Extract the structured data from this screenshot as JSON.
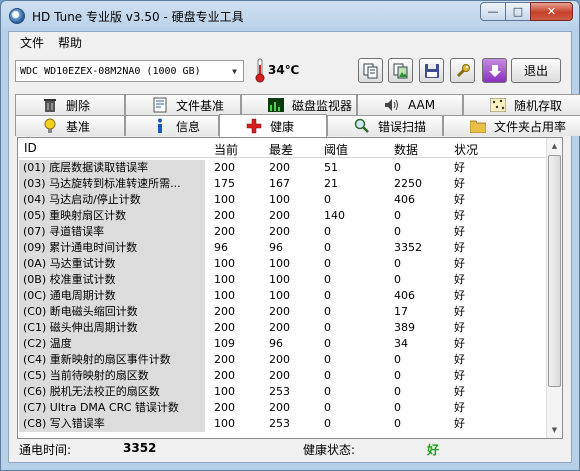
{
  "window": {
    "title": "HD Tune 专业版 v3.50 - 硬盘专业工具",
    "min_glyph": "—",
    "max_glyph": "□",
    "close_glyph": "✕"
  },
  "menu": [
    "文件",
    "帮助"
  ],
  "toolbar": {
    "drive": "WDC WD10EZEX-08M2NA0 (1000 GB)",
    "temperature": "34℃",
    "exit_label": "退出"
  },
  "tabs": {
    "row1": [
      {
        "label": "删除",
        "icon": "trash-icon"
      },
      {
        "label": "文件基准",
        "icon": "file-benchmark-icon"
      },
      {
        "label": "磁盘监视器",
        "icon": "disk-monitor-icon"
      },
      {
        "label": "AAM",
        "icon": "speaker-icon"
      },
      {
        "label": "随机存取",
        "icon": "random-access-icon"
      }
    ],
    "row2": [
      {
        "label": "基准",
        "icon": "lightbulb-icon"
      },
      {
        "label": "信息",
        "icon": "info-icon"
      },
      {
        "label": "健康",
        "icon": "red-cross-icon"
      },
      {
        "label": "错误扫描",
        "icon": "magnifier-icon"
      },
      {
        "label": "文件夹占用率",
        "icon": "folder-icon"
      }
    ],
    "active": "健康"
  },
  "table": {
    "headers": {
      "id": "ID",
      "current": "当前",
      "worst": "最差",
      "threshold": "阈值",
      "data": "数据",
      "status": "状况"
    },
    "rows": [
      {
        "id": "(01) 底层数据读取错误率",
        "current": "200",
        "worst": "200",
        "threshold": "51",
        "data": "0",
        "status": "好"
      },
      {
        "id": "(03) 马达旋转到标准转速所需...",
        "current": "175",
        "worst": "167",
        "threshold": "21",
        "data": "2250",
        "status": "好"
      },
      {
        "id": "(04) 马达启动/停止计数",
        "current": "100",
        "worst": "100",
        "threshold": "0",
        "data": "406",
        "status": "好"
      },
      {
        "id": "(05) 重映射扇区计数",
        "current": "200",
        "worst": "200",
        "threshold": "140",
        "data": "0",
        "status": "好"
      },
      {
        "id": "(07) 寻道错误率",
        "current": "200",
        "worst": "200",
        "threshold": "0",
        "data": "0",
        "status": "好"
      },
      {
        "id": "(09) 累计通电时间计数",
        "current": "96",
        "worst": "96",
        "threshold": "0",
        "data": "3352",
        "status": "好"
      },
      {
        "id": "(0A) 马达重试计数",
        "current": "100",
        "worst": "100",
        "threshold": "0",
        "data": "0",
        "status": "好"
      },
      {
        "id": "(0B) 校准重试计数",
        "current": "100",
        "worst": "100",
        "threshold": "0",
        "data": "0",
        "status": "好"
      },
      {
        "id": "(0C) 通电周期计数",
        "current": "100",
        "worst": "100",
        "threshold": "0",
        "data": "406",
        "status": "好"
      },
      {
        "id": "(C0) 断电磁头缩回计数",
        "current": "200",
        "worst": "200",
        "threshold": "0",
        "data": "17",
        "status": "好"
      },
      {
        "id": "(C1) 磁头伸出周期计数",
        "current": "200",
        "worst": "200",
        "threshold": "0",
        "data": "389",
        "status": "好"
      },
      {
        "id": "(C2) 温度",
        "current": "109",
        "worst": "96",
        "threshold": "0",
        "data": "34",
        "status": "好"
      },
      {
        "id": "(C4) 重新映射的扇区事件计数",
        "current": "200",
        "worst": "200",
        "threshold": "0",
        "data": "0",
        "status": "好"
      },
      {
        "id": "(C5) 当前待映射的扇区数",
        "current": "200",
        "worst": "200",
        "threshold": "0",
        "data": "0",
        "status": "好"
      },
      {
        "id": "(C6) 脱机无法校正的扇区数",
        "current": "100",
        "worst": "253",
        "threshold": "0",
        "data": "0",
        "status": "好"
      },
      {
        "id": "(C7) Ultra DMA CRC 错误计数",
        "current": "200",
        "worst": "200",
        "threshold": "0",
        "data": "0",
        "status": "好"
      },
      {
        "id": "(C8) 写入错误率",
        "current": "100",
        "worst": "253",
        "threshold": "0",
        "data": "0",
        "status": "好"
      }
    ]
  },
  "status": {
    "power_on_label": "通电时间:",
    "power_on_value": "3352",
    "health_label": "健康状态:",
    "health_value": "好",
    "health_color": "#1aa51a"
  }
}
